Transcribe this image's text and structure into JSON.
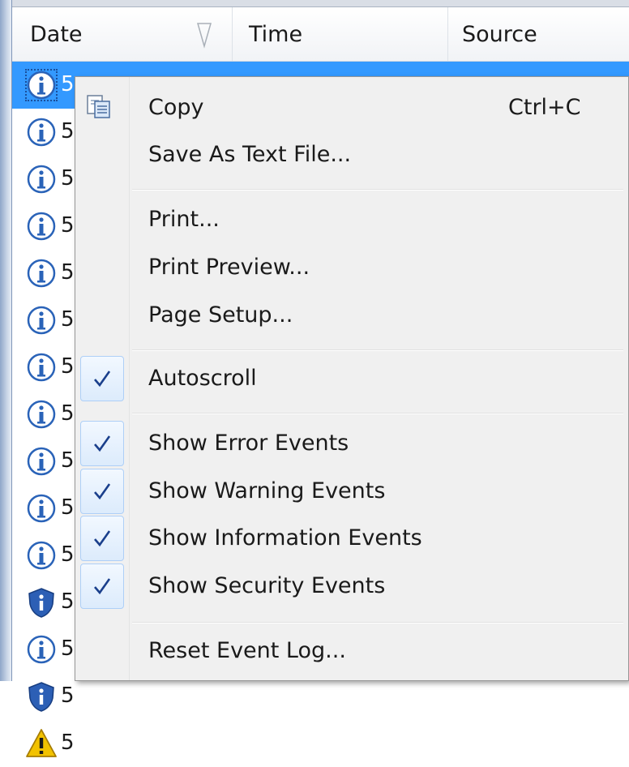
{
  "table": {
    "columns": {
      "date": "Date",
      "time": "Time",
      "source": "Source"
    },
    "rows": [
      {
        "icon": "information-icon",
        "text": "5",
        "selected": true
      },
      {
        "icon": "information-icon",
        "text": "5"
      },
      {
        "icon": "information-icon",
        "text": "5"
      },
      {
        "icon": "information-icon",
        "text": "5"
      },
      {
        "icon": "information-icon",
        "text": "5"
      },
      {
        "icon": "information-icon",
        "text": "5"
      },
      {
        "icon": "information-icon",
        "text": "5"
      },
      {
        "icon": "information-icon",
        "text": "5"
      },
      {
        "icon": "information-icon",
        "text": "5"
      },
      {
        "icon": "information-icon",
        "text": "5"
      },
      {
        "icon": "information-icon",
        "text": "5"
      },
      {
        "icon": "security-shield-icon",
        "text": "5"
      },
      {
        "icon": "information-icon",
        "text": "5"
      },
      {
        "icon": "security-shield-icon",
        "text": "5"
      },
      {
        "icon": "warning-icon",
        "text": "5"
      }
    ]
  },
  "context_menu": {
    "copy": {
      "label": "Copy",
      "shortcut": "Ctrl+C",
      "icon": "copy-icon"
    },
    "save_as_text": {
      "label": "Save As Text File..."
    },
    "print": {
      "label": "Print..."
    },
    "print_preview": {
      "label": "Print Preview..."
    },
    "page_setup": {
      "label": "Page Setup..."
    },
    "autoscroll": {
      "label": "Autoscroll",
      "checked": true
    },
    "show_error_events": {
      "label": "Show Error Events",
      "checked": true
    },
    "show_warning_events": {
      "label": "Show Warning Events",
      "checked": true
    },
    "show_information_events": {
      "label": "Show Information Events",
      "checked": true
    },
    "show_security_events": {
      "label": "Show Security Events",
      "checked": true
    },
    "reset_event_log": {
      "label": "Reset Event Log..."
    }
  },
  "colors": {
    "selection": "#3399ff",
    "menu_background": "#f0f0f0",
    "check_color": "#1a3f8c",
    "info_icon": "#2a63b8",
    "warning_icon": "#f2c200"
  }
}
